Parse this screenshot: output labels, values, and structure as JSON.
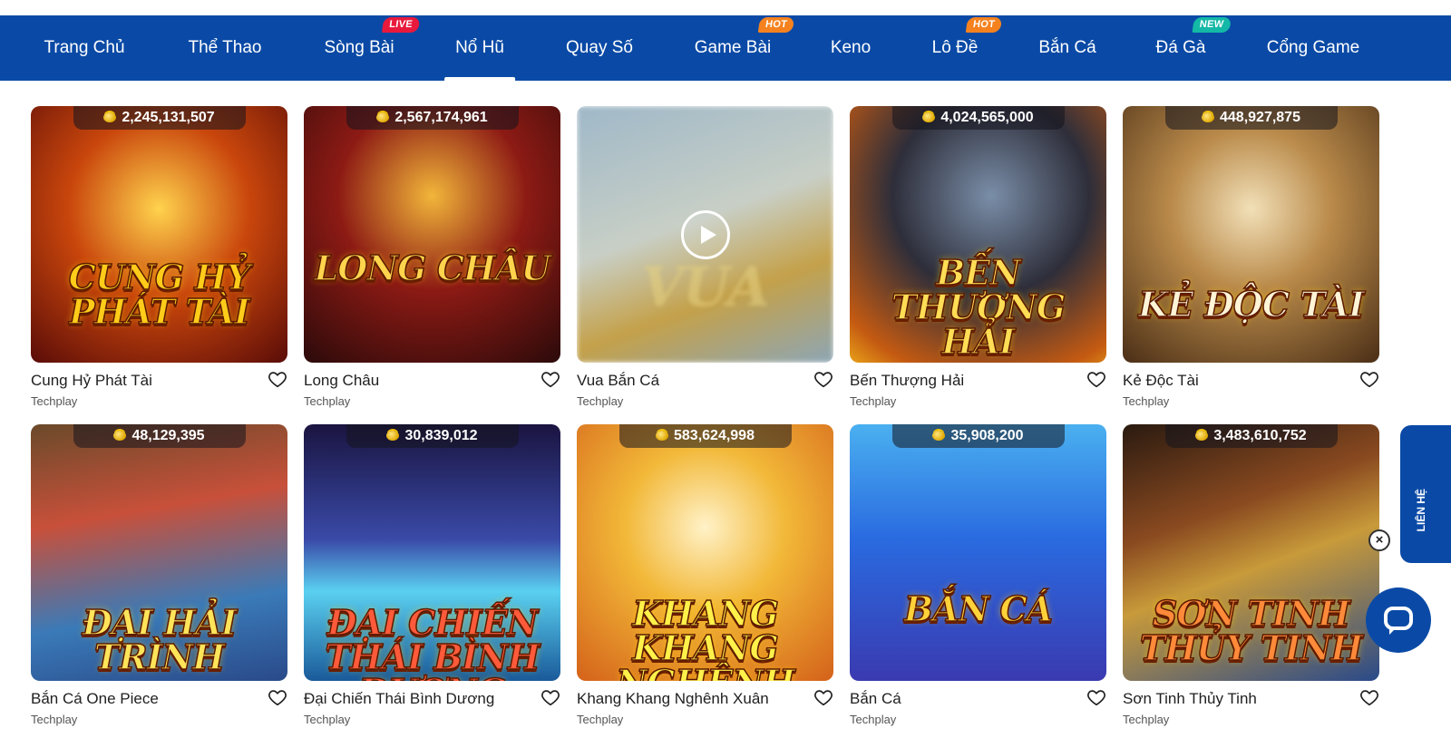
{
  "nav": {
    "items": [
      {
        "label": "Trang Chủ"
      },
      {
        "label": "Thể Thao"
      },
      {
        "label": "Sòng Bài",
        "badge": "LIVE",
        "badge_color": "#e8193c"
      },
      {
        "label": "Nổ Hũ",
        "active": true
      },
      {
        "label": "Quay Số"
      },
      {
        "label": "Game Bài",
        "badge": "HOT",
        "badge_color": "#f5821f"
      },
      {
        "label": "Keno"
      },
      {
        "label": "Lô Đề",
        "badge": "HOT",
        "badge_color": "#f5821f"
      },
      {
        "label": "Bắn Cá"
      },
      {
        "label": "Đá Gà",
        "badge": "NEW",
        "badge_color": "#14b8a6"
      },
      {
        "label": "Cổng Game"
      }
    ]
  },
  "games": [
    {
      "name": "Cung Hỷ Phát Tài",
      "provider": "Techplay",
      "jackpot": "2,245,131,507",
      "art": "CUNG HỶ PHÁT TÀI"
    },
    {
      "name": "Long Châu",
      "provider": "Techplay",
      "jackpot": "2,567,174,961",
      "art": "LONG CHÂU"
    },
    {
      "name": "Vua Bắn Cá",
      "provider": "Techplay",
      "art": "VUA",
      "video": true
    },
    {
      "name": "Bến Thượng Hải",
      "provider": "Techplay",
      "jackpot": "4,024,565,000",
      "art": "BẾN THƯỢNG HẢI"
    },
    {
      "name": "Kẻ Độc Tài",
      "provider": "Techplay",
      "jackpot": "448,927,875",
      "art": "KẺ ĐỘC TÀI"
    },
    {
      "name": "Bắn Cá One Piece",
      "provider": "Techplay",
      "jackpot": "48,129,395",
      "art": "ĐẠI HẢI TRÌNH"
    },
    {
      "name": "Đại Chiến Thái Bình Dương",
      "provider": "Techplay",
      "jackpot": "30,839,012",
      "art": "ĐẠI CHIẾN THÁI BÌNH DƯƠNG"
    },
    {
      "name": "Khang Khang Nghênh Xuân",
      "provider": "Techplay",
      "jackpot": "583,624,998",
      "art": "KHANG KHANG NGHÊNH XUÂN"
    },
    {
      "name": "Bắn Cá",
      "provider": "Techplay",
      "jackpot": "35,908,200",
      "art": "BẮN CÁ"
    },
    {
      "name": "Sơn Tinh Thủy Tinh",
      "provider": "Techplay",
      "jackpot": "3,483,610,752",
      "art": "SƠN TINH THỦY TINH"
    }
  ],
  "colors": {
    "nav_bg": "#0a4aa6",
    "accent": "#0a4aa6"
  },
  "contact": {
    "label": "LIÊN HỆ",
    "close": "×"
  },
  "icons": {
    "heart": "heart-icon",
    "coin": "coin-icon",
    "play": "play-icon",
    "chat": "chat-icon"
  }
}
